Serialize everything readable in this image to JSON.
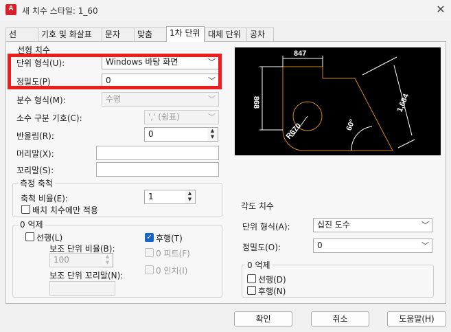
{
  "window": {
    "title": "새 치수 스타일: 1_60",
    "app_icon_text": "A"
  },
  "tabs": [
    "선",
    "기호 및 화살표",
    "문자",
    "맞춤",
    "1차 단위",
    "대체 단위",
    "공차"
  ],
  "linear": {
    "group_label": "선형 치수",
    "unit_format_label": "단위 형식(U):",
    "unit_format_value": "Windows 바탕 화면",
    "precision_label": "정밀도(P)",
    "precision_value": "0",
    "fraction_label": "분수 형식(M):",
    "fraction_value": "수평",
    "decimal_sep_label": "소수 구분 기호(C):",
    "decimal_sep_value": "','  (쉼표)",
    "roundoff_label": "반올림(R):",
    "roundoff_value": "0",
    "prefix_label": "머리말(X):",
    "prefix_value": "",
    "suffix_label": "꼬리말(S):",
    "suffix_value": ""
  },
  "scale": {
    "group_label": "측정 축척",
    "factor_label": "축척 비율(E):",
    "factor_value": "1",
    "layout_only_label": "배치 치수에만 적용"
  },
  "zero_left": {
    "group_label": "0 억제",
    "leading_label": "선행(L)",
    "sub_factor_label": "보조 단위 비율(B):",
    "sub_factor_value": "100",
    "sub_suffix_label": "보조 단위 꼬리말(N):",
    "sub_suffix_value": "",
    "trailing_label": "후행(T)",
    "feet_label": "0 피트(F)",
    "inches_label": "0 인치(I)"
  },
  "angular": {
    "group_label": "각도 치수",
    "unit_format_label": "단위 형식(A):",
    "unit_format_value": "십진 도수",
    "precision_label": "정밀도(O):",
    "precision_value": "0",
    "zero_group_label": "0 억제",
    "leading_label": "선행(D)",
    "trailing_label": "후행(N)"
  },
  "preview": {
    "dim_top": "847",
    "dim_left": "868",
    "dim_diag": "1,684",
    "dim_radius": "R670",
    "dim_angle": "60°"
  },
  "buttons": {
    "ok": "확인",
    "cancel": "취소",
    "help": "도움말(H)"
  },
  "colors": {
    "highlight": "#ee1c1c",
    "preview_bg": "#000000",
    "check_on": "#1a63c8",
    "shape": "#d08a1e"
  }
}
